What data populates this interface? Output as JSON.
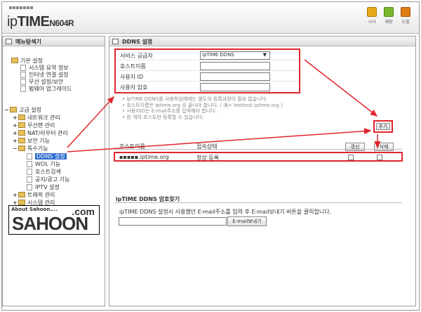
{
  "header": {
    "brand_light": "ip",
    "brand_bold": "TIME",
    "model": "N604R",
    "buttons": [
      {
        "label": "시사",
        "icon": "monitor-icon",
        "color": "#e6a817"
      },
      {
        "label": "재랑",
        "icon": "save-icon",
        "color": "#7ab82e"
      },
      {
        "label": "도움",
        "icon": "help-icon",
        "color": "#e07c17"
      }
    ]
  },
  "sidebar": {
    "title": "메뉴탐색기",
    "basic": "기본 설정",
    "basic_items": [
      "시스템 요약 정보",
      "인터넷 연결 설정",
      "무선 설정/보안",
      "펌웨어 업그레이드"
    ],
    "advanced": "고급 설정",
    "adv_items": [
      "네트워크 관리",
      "무선랜 관리",
      "NAT/라우터 관리",
      "보안 기능",
      "특수기능"
    ],
    "special_items": [
      "DDNS 설정",
      "WOL 기능",
      "호스트검색",
      "공지/광고 기능",
      "IPTV 설정"
    ],
    "more_items": [
      "트래픽 관리",
      "시스템 관리"
    ],
    "selected": "DDNS 설정"
  },
  "watermark": {
    "about": "About Sahoon....",
    "com": ".com",
    "name": "SAHOON"
  },
  "main": {
    "title": "DDNS 설정",
    "form": {
      "provider_label": "서비스 공급자",
      "provider_value": "ipTIME DDNS",
      "hostname_label": "호스트이름",
      "userid_label": "사용자 ID",
      "password_label": "사용자 암호"
    },
    "notes": [
      "ipTIME DDNS를 사용하실때에는 별도의 등록과정이 필요 없습니다.",
      "호스트이름은 iptime.org 로 끝나야 합니다. ( 예> testtest.iptime.org )",
      "사용자ID는 E-mail주소를 입력해야 합니다.",
      "한 개의 호스트만 등록할 수 있습니다."
    ],
    "add_button": "추가",
    "table": {
      "col_host": "호스트이름",
      "col_status": "접속상태",
      "refresh_button": "갱신",
      "delete_button": "삭제",
      "rows": [
        {
          "host": "▪▪▪▪▪.iptime.org",
          "status": "정상 등록"
        }
      ]
    },
    "password_section": {
      "title": "ipTIME DDNS 암호찾기",
      "desc": "ipTIME DDNS 설정시 사용했던 E-mail주소를 입력 후 E-mail보내기 버튼을 클릭합니다.",
      "send_button": "E-mail보내기"
    }
  },
  "colors": {
    "highlight": "#e0252c",
    "selection": "#2f6ccf"
  }
}
